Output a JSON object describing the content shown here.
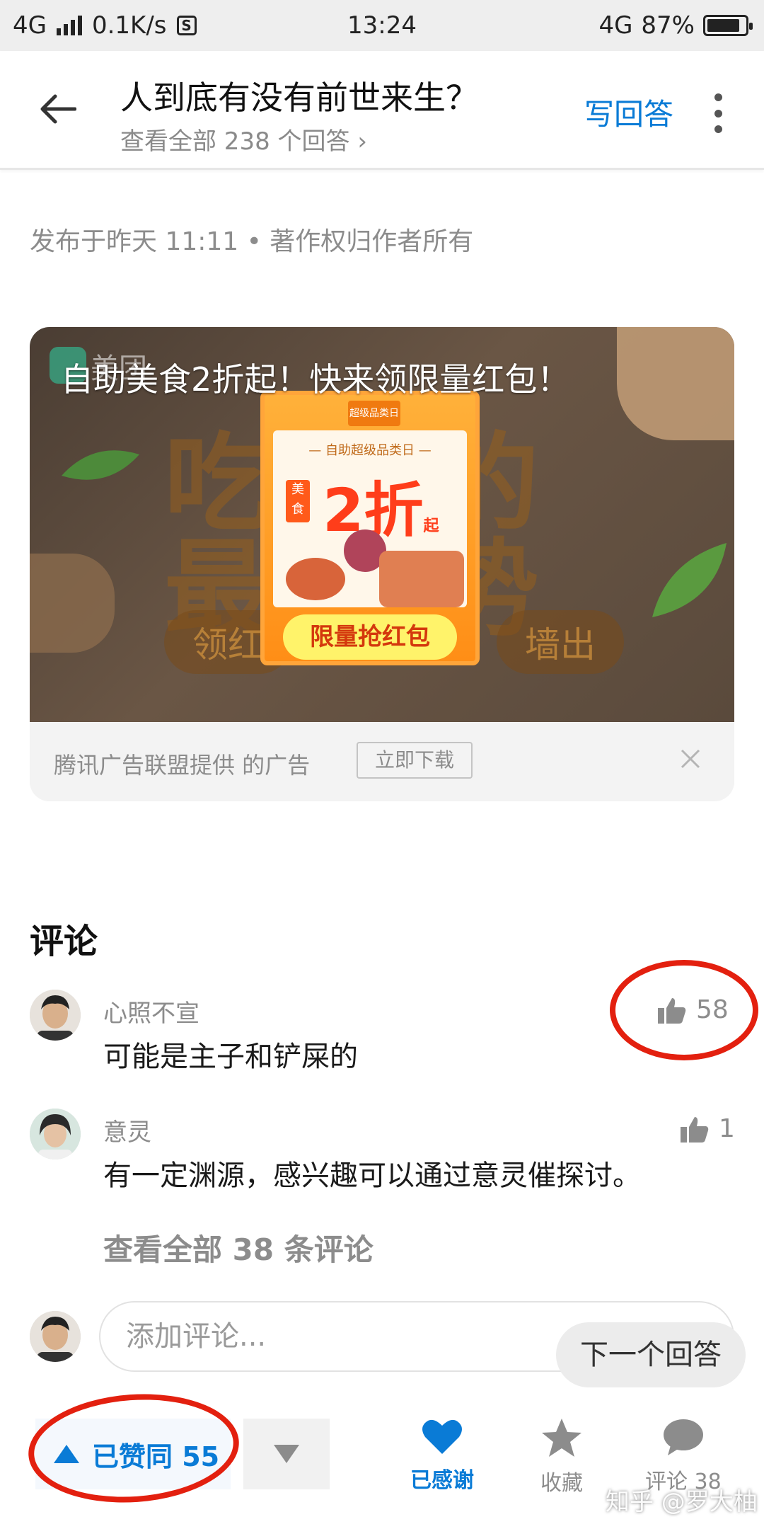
{
  "status_bar": {
    "network": "4G",
    "speed": "0.1K/s",
    "s_icon": "S",
    "time": "13:24",
    "network_right": "4G",
    "battery": "87%",
    "battery_level": 0.87
  },
  "header": {
    "title": "人到底有没有前世来生？",
    "subtitle": "查看全部 238 个回答 ›",
    "write_answer": "写回答"
  },
  "answer": {
    "published": "发布于昨天 11:11 • 著作权归作者所有"
  },
  "ad": {
    "brand": "美团",
    "headline": "自助美食2折起！快来领限量红包！",
    "bg_text_1": "吃饭的",
    "bg_text_2": "最大势",
    "pill_left": "领红",
    "pill_right": "墙出",
    "card_top": "超级品类日",
    "card_sub": "— 自助超级品类日 —",
    "card_tag": "美食",
    "card_big": "2折",
    "card_big_suffix": "起",
    "card_button": "限量抢红包",
    "source": "腾讯广告联盟提供 的广告",
    "download": "立即下载"
  },
  "comments": {
    "heading": "评论",
    "items": [
      {
        "name": "心照不宣",
        "text": "可能是主子和铲屎的",
        "likes": "58"
      },
      {
        "name": "意灵",
        "text": "有一定渊源，感兴趣可以通过意灵催探讨。",
        "likes": "1"
      }
    ],
    "view_all": "查看全部 38 条评论",
    "add_placeholder": "添加评论...",
    "next_answer": "下一个回答"
  },
  "bottom_bar": {
    "upvote": "已赞同 55",
    "thanks": "已感谢",
    "collect": "收藏",
    "comment": "评论 38"
  },
  "watermark": "知乎 @罗大柚",
  "colors": {
    "accent": "#0a7bd6",
    "annotation_red": "#e3200f"
  }
}
